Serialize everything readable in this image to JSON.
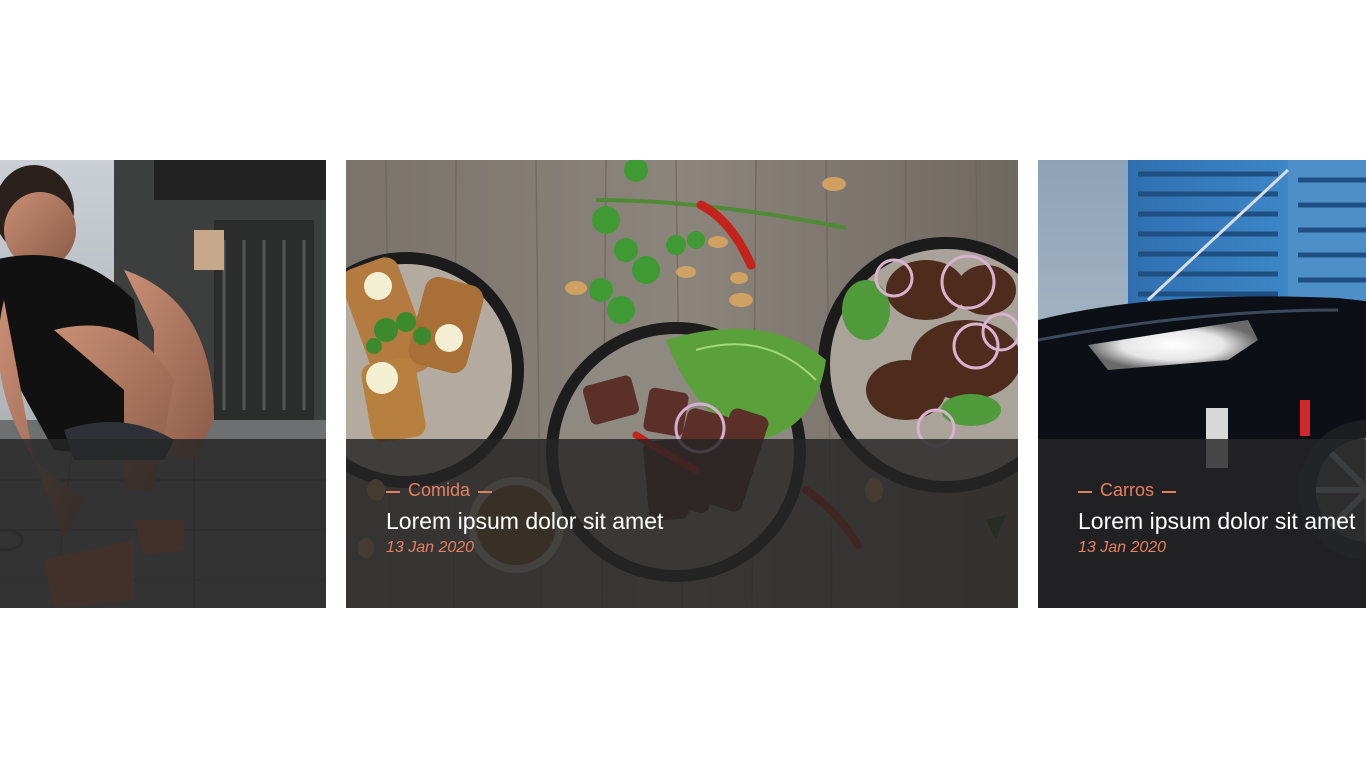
{
  "colors": {
    "accent": "#e5805f",
    "overlay": "rgba(38,38,38,0.82)",
    "title": "#ffffff",
    "background": "#ffffff"
  },
  "cards": [
    {
      "image": "athlete-tying-sneaker-photo",
      "category": "",
      "title": "",
      "date": ""
    },
    {
      "image": "food-bowls-on-wooden-table-photo",
      "category": "Comida",
      "title": "Lorem ipsum dolor sit amet",
      "date": "13 Jan 2020"
    },
    {
      "image": "black-car-headlight-city-photo",
      "category": "Carros",
      "title": "Lorem ipsum dolor sit amet",
      "date": "13 Jan 2020"
    }
  ]
}
